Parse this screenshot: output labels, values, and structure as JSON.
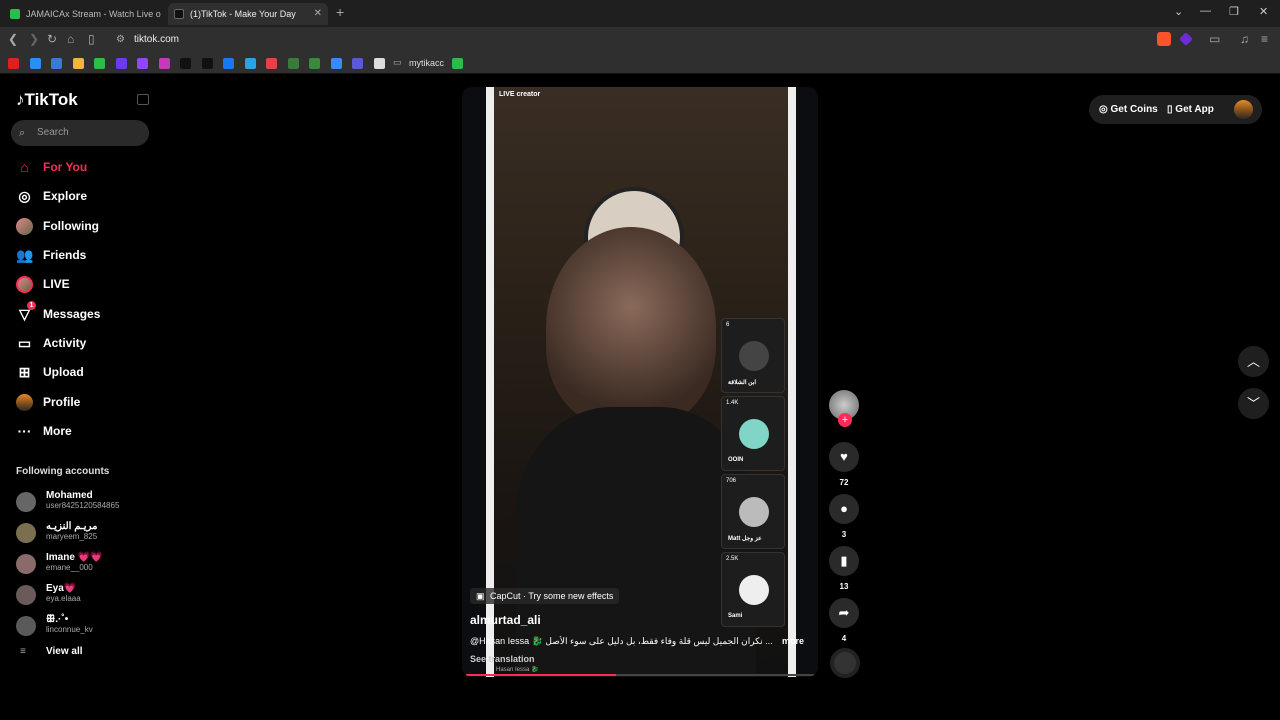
{
  "browser": {
    "tabs": [
      {
        "label": "JAMAICAx Stream - Watch Live o",
        "color": "#2dbb4a"
      },
      {
        "label": "(1)TikTok - Make Your Day",
        "color": "#111111"
      }
    ],
    "url": "tiktok.com",
    "bookmarks_folder": "mytikacc",
    "bookmark_colors": [
      "#e02020",
      "#2a8ef5",
      "#3a7bd5",
      "#f2b43c",
      "#2dbb4a",
      "#6a3af5",
      "#9146ff",
      "#c83ab5",
      "#111111",
      "#111111",
      "#1877f2",
      "#2aa3e0",
      "#e04545",
      "#3a7a3a",
      "#3a8a3a",
      "#3a8aff",
      "#5a5ad5",
      "#dddddd",
      "#2dbb4a"
    ]
  },
  "sidebar": {
    "logo": "TikTok",
    "search_placeholder": "Search",
    "nav": [
      {
        "label": "For You",
        "icon": "home-icon",
        "active": true
      },
      {
        "label": "Explore",
        "icon": "compass-icon"
      },
      {
        "label": "Following",
        "icon": "following-avatar-icon"
      },
      {
        "label": "Friends",
        "icon": "friends-icon"
      },
      {
        "label": "LIVE",
        "icon": "live-icon"
      },
      {
        "label": "Messages",
        "icon": "messages-icon",
        "badge": "1"
      },
      {
        "label": "Activity",
        "icon": "activity-icon"
      },
      {
        "label": "Upload",
        "icon": "upload-icon"
      },
      {
        "label": "Profile",
        "icon": "profile-avatar-icon"
      },
      {
        "label": "More",
        "icon": "more-icon"
      }
    ],
    "following_header": "Following accounts",
    "accounts": [
      {
        "name": "Mohamed",
        "user": "user8425120584865"
      },
      {
        "name": "مريـم النزيـه",
        "user": "maryeem_825"
      },
      {
        "name": "Imane 💗💗",
        "user": "emane__000"
      },
      {
        "name": "Eya💗",
        "user": "eya.elaaa"
      },
      {
        "name": "ꕥ.·˚•",
        "user": "linconnue_kv"
      }
    ],
    "view_all": "View all"
  },
  "video": {
    "live_tag": "LIVE creator",
    "guests": [
      {
        "count": "6",
        "name": "ابن الشلاقة"
      },
      {
        "count": "1.4K",
        "name": "OOIN"
      },
      {
        "count": "706",
        "name": "Matt عز وجل"
      },
      {
        "count": "2.5K",
        "name": "Sami"
      }
    ],
    "capcut": "CapCut · Try some new effects",
    "author": "almurtad_ali",
    "description": "@Hasan Iessa 🐉 نكران الجميل ليس قلة وفاء فقط، بل دليل على سوء الأصل ...",
    "more": "more",
    "see_translation": "See translation",
    "music": "Hasan Iessa 🐉",
    "progress": 0.43
  },
  "actions": {
    "likes": "72",
    "comments": "3",
    "saves": "13",
    "shares": "4"
  },
  "header": {
    "get_coins": "Get Coins",
    "get_app": "Get App"
  }
}
